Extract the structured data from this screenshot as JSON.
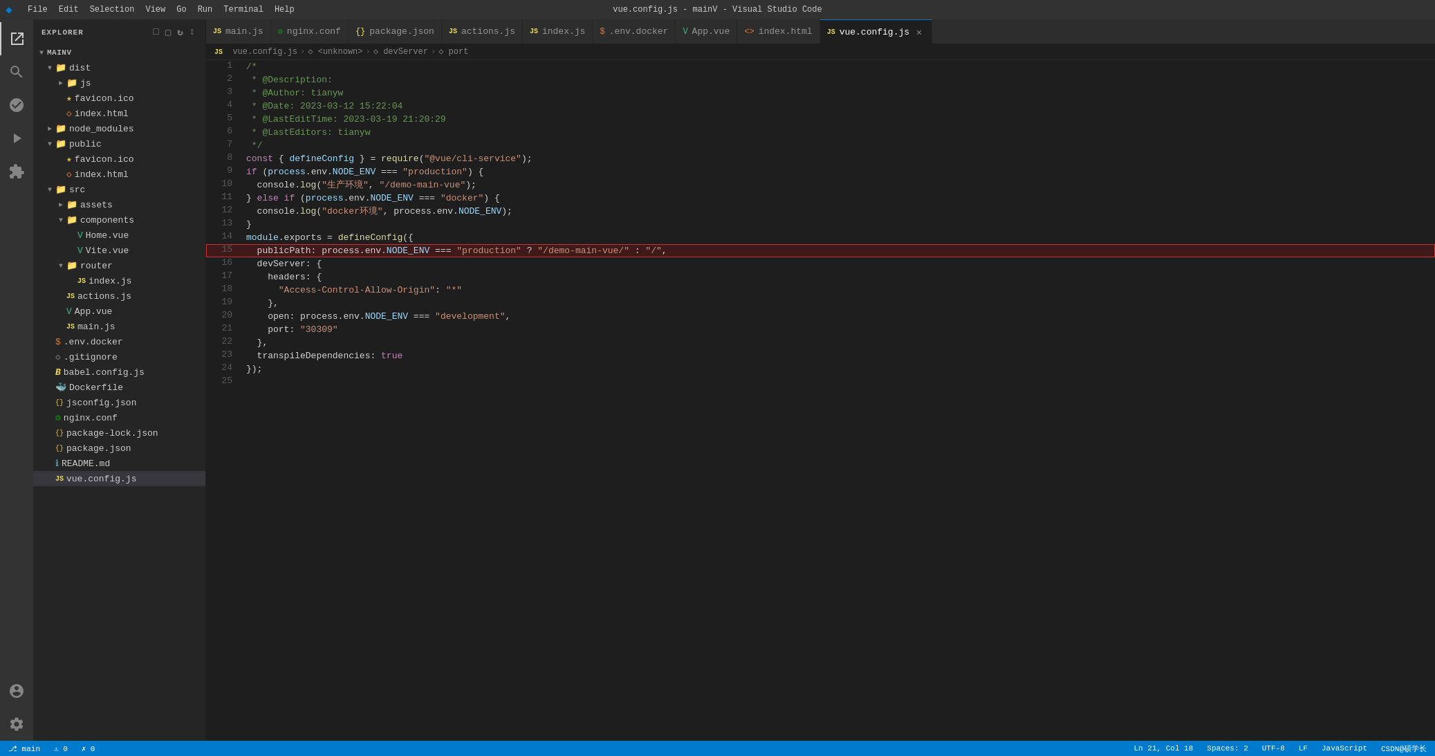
{
  "titleBar": {
    "title": "vue.config.js - mainV - Visual Studio Code",
    "logo": "VS",
    "menuItems": [
      "File",
      "Edit",
      "Selection",
      "View",
      "Go",
      "Run",
      "Terminal",
      "Help"
    ]
  },
  "tabs": [
    {
      "id": "main.js",
      "label": "main.js",
      "icon": "JS",
      "iconColor": "#f0e05a",
      "active": false,
      "modified": false
    },
    {
      "id": "nginx.conf",
      "label": "nginx.conf",
      "icon": "⚙",
      "iconColor": "#009900",
      "active": false,
      "modified": false
    },
    {
      "id": "package.json",
      "label": "package.json",
      "icon": "{}",
      "iconColor": "#f0e05a",
      "active": false,
      "modified": false
    },
    {
      "id": "actions.js",
      "label": "actions.js",
      "icon": "JS",
      "iconColor": "#f0e05a",
      "active": false,
      "modified": false
    },
    {
      "id": "index.js",
      "label": "index.js",
      "icon": "JS",
      "iconColor": "#f0e05a",
      "active": false,
      "modified": false
    },
    {
      "id": ".env.docker",
      "label": ".env.docker",
      "icon": "$",
      "iconColor": "#e37933",
      "active": false,
      "modified": false
    },
    {
      "id": "App.vue",
      "label": "App.vue",
      "icon": "V",
      "iconColor": "#42b883",
      "active": false,
      "modified": false
    },
    {
      "id": "index.html",
      "label": "index.html",
      "icon": "<>",
      "iconColor": "#e37933",
      "active": false,
      "modified": false
    },
    {
      "id": "vue.config.js",
      "label": "vue.config.js",
      "icon": "JS",
      "iconColor": "#f0e05a",
      "active": true,
      "modified": false
    }
  ],
  "breadcrumb": {
    "items": [
      "vue.config.js",
      "<unknown>",
      "devServer",
      "port"
    ]
  },
  "sidebar": {
    "title": "EXPLORER",
    "rootName": "MAINV",
    "tree": [
      {
        "level": 1,
        "type": "folder",
        "open": true,
        "name": "dist"
      },
      {
        "level": 2,
        "type": "folder",
        "open": true,
        "name": "js"
      },
      {
        "level": 2,
        "type": "file-star",
        "name": "favicon.ico",
        "icon": "★",
        "iconColor": "#e8bf46"
      },
      {
        "level": 2,
        "type": "file",
        "name": "index.html",
        "icon": "<>",
        "iconColor": "#e37933"
      },
      {
        "level": 1,
        "type": "folder",
        "open": false,
        "name": "node_modules"
      },
      {
        "level": 1,
        "type": "folder",
        "open": true,
        "name": "public"
      },
      {
        "level": 2,
        "type": "file-star",
        "name": "favicon.ico",
        "icon": "★",
        "iconColor": "#e8bf46"
      },
      {
        "level": 2,
        "type": "file",
        "name": "index.html",
        "icon": "<>",
        "iconColor": "#e37933"
      },
      {
        "level": 1,
        "type": "folder",
        "open": true,
        "name": "src"
      },
      {
        "level": 2,
        "type": "folder",
        "open": false,
        "name": "assets"
      },
      {
        "level": 2,
        "type": "folder",
        "open": true,
        "name": "components"
      },
      {
        "level": 3,
        "type": "file-vue",
        "name": "Home.vue",
        "icon": "V",
        "iconColor": "#42b883"
      },
      {
        "level": 3,
        "type": "file-vue",
        "name": "Vite.vue",
        "icon": "V",
        "iconColor": "#42b883"
      },
      {
        "level": 2,
        "type": "folder",
        "open": true,
        "name": "router"
      },
      {
        "level": 3,
        "type": "file-js",
        "name": "index.js",
        "icon": "JS",
        "iconColor": "#f0e05a"
      },
      {
        "level": 2,
        "type": "file-js",
        "name": "actions.js",
        "icon": "JS",
        "iconColor": "#f0e05a"
      },
      {
        "level": 2,
        "type": "file-vue",
        "name": "App.vue",
        "icon": "V",
        "iconColor": "#42b883"
      },
      {
        "level": 2,
        "type": "file-js",
        "name": "main.js",
        "icon": "JS",
        "iconColor": "#f0e05a"
      },
      {
        "level": 1,
        "type": "file",
        "name": ".env.docker",
        "icon": "$",
        "iconColor": "#e37933"
      },
      {
        "level": 1,
        "type": "file",
        "name": ".gitignore",
        "icon": "◇",
        "iconColor": "#858585"
      },
      {
        "level": 1,
        "type": "file",
        "name": "babel.config.js",
        "icon": "B",
        "iconColor": "#f5da55"
      },
      {
        "level": 1,
        "type": "file",
        "name": "Dockerfile",
        "icon": "🐳",
        "iconColor": "#2496ed"
      },
      {
        "level": 1,
        "type": "file",
        "name": "jsconfig.json",
        "icon": "{}",
        "iconColor": "#f0e05a"
      },
      {
        "level": 1,
        "type": "file",
        "name": "nginx.conf",
        "icon": "⚙",
        "iconColor": "#009900"
      },
      {
        "level": 1,
        "type": "file",
        "name": "package-lock.json",
        "icon": "{}",
        "iconColor": "#f0e05a"
      },
      {
        "level": 1,
        "type": "file",
        "name": "package.json",
        "icon": "{}",
        "iconColor": "#f0e05a"
      },
      {
        "level": 1,
        "type": "file",
        "name": "README.md",
        "icon": "ℹ",
        "iconColor": "#519aba"
      },
      {
        "level": 1,
        "type": "file",
        "name": "vue.config.js",
        "icon": "JS",
        "iconColor": "#f0e05a",
        "active": true
      }
    ]
  },
  "codeLines": [
    {
      "num": 1,
      "tokens": [
        {
          "text": "/*",
          "class": "c-comment"
        }
      ]
    },
    {
      "num": 2,
      "tokens": [
        {
          "text": " * @Description: ",
          "class": "c-comment"
        }
      ]
    },
    {
      "num": 3,
      "tokens": [
        {
          "text": " * @Author: tianyw",
          "class": "c-comment"
        }
      ]
    },
    {
      "num": 4,
      "tokens": [
        {
          "text": " * @Date: 2023-03-12 15:22:04",
          "class": "c-comment"
        }
      ]
    },
    {
      "num": 5,
      "tokens": [
        {
          "text": " * @LastEditTime: 2023-03-19 21:20:29",
          "class": "c-comment"
        }
      ]
    },
    {
      "num": 6,
      "tokens": [
        {
          "text": " * @LastEditors: tianyw",
          "class": "c-comment"
        }
      ]
    },
    {
      "num": 7,
      "tokens": [
        {
          "text": " */",
          "class": "c-comment"
        }
      ]
    },
    {
      "num": 8,
      "tokens": [
        {
          "text": "const",
          "class": "c-keyword"
        },
        {
          "text": " { ",
          "class": "c-plain"
        },
        {
          "text": "defineConfig",
          "class": "c-variable"
        },
        {
          "text": " } = ",
          "class": "c-plain"
        },
        {
          "text": "require",
          "class": "c-yellow"
        },
        {
          "text": "(",
          "class": "c-plain"
        },
        {
          "text": "\"@vue/cli-service\"",
          "class": "c-string"
        },
        {
          "text": ");",
          "class": "c-plain"
        }
      ]
    },
    {
      "num": 9,
      "tokens": [
        {
          "text": "if",
          "class": "c-keyword"
        },
        {
          "text": " (",
          "class": "c-plain"
        },
        {
          "text": "process",
          "class": "c-variable"
        },
        {
          "text": ".env.",
          "class": "c-plain"
        },
        {
          "text": "NODE_ENV",
          "class": "c-variable"
        },
        {
          "text": " === ",
          "class": "c-plain"
        },
        {
          "text": "\"production\"",
          "class": "c-string"
        },
        {
          "text": ") {",
          "class": "c-plain"
        }
      ]
    },
    {
      "num": 10,
      "tokens": [
        {
          "text": "  console.",
          "class": "c-plain"
        },
        {
          "text": "log",
          "class": "c-yellow"
        },
        {
          "text": "(",
          "class": "c-plain"
        },
        {
          "text": "\"生产环境\"",
          "class": "c-string"
        },
        {
          "text": ", ",
          "class": "c-plain"
        },
        {
          "text": "\"/demo-main-vue\"",
          "class": "c-string"
        },
        {
          "text": ");",
          "class": "c-plain"
        }
      ]
    },
    {
      "num": 11,
      "tokens": [
        {
          "text": "} ",
          "class": "c-plain"
        },
        {
          "text": "else if",
          "class": "c-keyword"
        },
        {
          "text": " (",
          "class": "c-plain"
        },
        {
          "text": "process",
          "class": "c-variable"
        },
        {
          "text": ".env.",
          "class": "c-plain"
        },
        {
          "text": "NODE_ENV",
          "class": "c-variable"
        },
        {
          "text": " === ",
          "class": "c-plain"
        },
        {
          "text": "\"docker\"",
          "class": "c-string"
        },
        {
          "text": ") {",
          "class": "c-plain"
        }
      ]
    },
    {
      "num": 12,
      "tokens": [
        {
          "text": "  console.",
          "class": "c-plain"
        },
        {
          "text": "log",
          "class": "c-yellow"
        },
        {
          "text": "(",
          "class": "c-plain"
        },
        {
          "text": "\"docker环境\"",
          "class": "c-string"
        },
        {
          "text": ", process.env.",
          "class": "c-plain"
        },
        {
          "text": "NODE_ENV",
          "class": "c-variable"
        },
        {
          "text": ");",
          "class": "c-plain"
        }
      ]
    },
    {
      "num": 13,
      "tokens": [
        {
          "text": "}",
          "class": "c-plain"
        }
      ]
    },
    {
      "num": 14,
      "tokens": [
        {
          "text": "module",
          "class": "c-variable"
        },
        {
          "text": ".exports = ",
          "class": "c-plain"
        },
        {
          "text": "defineConfig",
          "class": "c-yellow"
        },
        {
          "text": "({",
          "class": "c-plain"
        }
      ]
    },
    {
      "num": 15,
      "highlighted": true,
      "tokens": [
        {
          "text": "  publicPath: process.env.",
          "class": "c-plain"
        },
        {
          "text": "NODE_ENV",
          "class": "c-variable"
        },
        {
          "text": " === ",
          "class": "c-plain"
        },
        {
          "text": "\"production\"",
          "class": "c-string"
        },
        {
          "text": " ? ",
          "class": "c-plain"
        },
        {
          "text": "\"/demo-main-vue/\"",
          "class": "c-string"
        },
        {
          "text": " : ",
          "class": "c-plain"
        },
        {
          "text": "\"/\"",
          "class": "c-string"
        },
        {
          "text": ",",
          "class": "c-plain"
        }
      ]
    },
    {
      "num": 16,
      "tokens": [
        {
          "text": "  devServer: {",
          "class": "c-plain"
        }
      ]
    },
    {
      "num": 17,
      "tokens": [
        {
          "text": "    headers: {",
          "class": "c-plain"
        }
      ]
    },
    {
      "num": 18,
      "tokens": [
        {
          "text": "      ",
          "class": "c-plain"
        },
        {
          "text": "\"Access-Control-Allow-Origin\"",
          "class": "c-string"
        },
        {
          "text": ": ",
          "class": "c-plain"
        },
        {
          "text": "\"*\"",
          "class": "c-string"
        }
      ]
    },
    {
      "num": 19,
      "tokens": [
        {
          "text": "    },",
          "class": "c-plain"
        }
      ]
    },
    {
      "num": 20,
      "tokens": [
        {
          "text": "    open: process.env.",
          "class": "c-plain"
        },
        {
          "text": "NODE_ENV",
          "class": "c-variable"
        },
        {
          "text": " === ",
          "class": "c-plain"
        },
        {
          "text": "\"development\"",
          "class": "c-string"
        },
        {
          "text": ",",
          "class": "c-plain"
        }
      ]
    },
    {
      "num": 21,
      "tokens": [
        {
          "text": "    port: ",
          "class": "c-plain"
        },
        {
          "text": "\"30309\"",
          "class": "c-string"
        }
      ]
    },
    {
      "num": 22,
      "tokens": [
        {
          "text": "  },",
          "class": "c-plain"
        }
      ]
    },
    {
      "num": 23,
      "tokens": [
        {
          "text": "  transpileDependencies: ",
          "class": "c-plain"
        },
        {
          "text": "true",
          "class": "c-keyword"
        }
      ]
    },
    {
      "num": 24,
      "tokens": [
        {
          "text": "});",
          "class": "c-plain"
        }
      ]
    },
    {
      "num": 25,
      "tokens": [
        {
          "text": "",
          "class": "c-plain"
        }
      ]
    }
  ],
  "statusBar": {
    "left": [
      "⎇ main",
      "⚠ 0",
      "✗ 0"
    ],
    "right": [
      "Ln 21, Col 18",
      "Spaces: 2",
      "UTF-8",
      "LF",
      "JavaScript",
      "CSDN@硕学长"
    ]
  },
  "watermark": "CSDN@硕学长"
}
